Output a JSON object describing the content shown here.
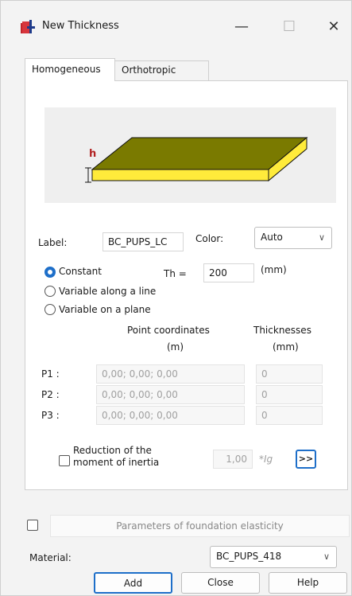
{
  "window": {
    "title": "New Thickness",
    "minimize_glyph": "—",
    "maximize_glyph": "☐",
    "close_glyph": "✕"
  },
  "tabs": [
    {
      "label": "Homogeneous",
      "active": true
    },
    {
      "label": "Orthotropic",
      "active": false
    }
  ],
  "preview": {
    "height_label": "h",
    "plate_color": "#7a7a00",
    "edge_color": "#ffeb3b"
  },
  "label_row": {
    "label_text": "Label:",
    "label_value": "BC_PUPS_LC",
    "color_text": "Color:",
    "color_value": "Auto"
  },
  "thickness_mode": {
    "options": [
      "Constant",
      "Variable along a line",
      "Variable on a plane"
    ],
    "selected": "Constant",
    "th_label": "Th =",
    "th_value": "200",
    "th_unit": "(mm)"
  },
  "points": {
    "coord_header": "Point coordinates",
    "coord_unit": "(m)",
    "thick_header": "Thicknesses",
    "thick_unit": "(mm)",
    "rows": [
      {
        "label": "P1 :",
        "coords": "0,00; 0,00; 0,00",
        "thickness": "0"
      },
      {
        "label": "P2 :",
        "coords": "0,00; 0,00; 0,00",
        "thickness": "0"
      },
      {
        "label": "P3 :",
        "coords": "0,00; 0,00; 0,00",
        "thickness": "0"
      }
    ]
  },
  "reduction": {
    "label_line1": "Reduction of the",
    "label_line2": "moment of inertia",
    "value": "1,00",
    "unit": "*Ig",
    "more_button": ">>"
  },
  "foundation": {
    "label": "Parameters of foundation elasticity"
  },
  "material": {
    "label": "Material:",
    "value": "BC_PUPS_418"
  },
  "buttons": {
    "add": "Add",
    "close": "Close",
    "help": "Help"
  },
  "colors": {
    "accent": "#1e6fc9",
    "icon_red": "#c0242b"
  }
}
